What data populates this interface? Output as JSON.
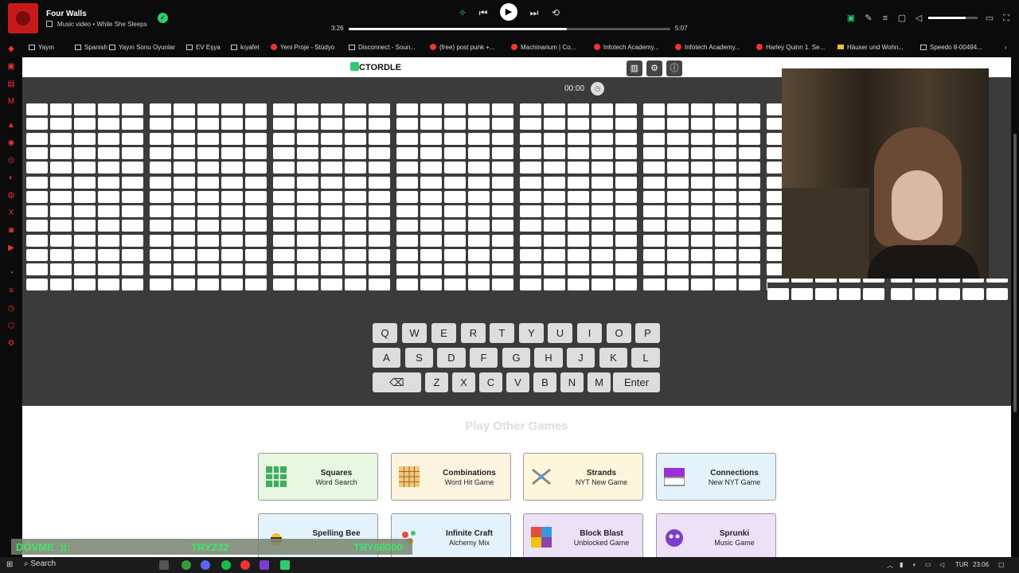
{
  "player": {
    "title": "Four Walls",
    "subtitle": "Music video • While She Sleeps",
    "current_time": "3:26",
    "total_time": "5:07",
    "progress": 0.678,
    "volume": 0.75
  },
  "bookmarks": [
    {
      "label": "Yayın",
      "icon": "folder"
    },
    {
      "label": "Spanish",
      "icon": "folder"
    },
    {
      "label": "Yayın Sonu Oyunlar",
      "icon": "folder"
    },
    {
      "label": "EV Eşya",
      "icon": "folder"
    },
    {
      "label": "kıyafet",
      "icon": "folder"
    },
    {
      "label": "Yeni Proje - Stüdyo",
      "icon": "red"
    },
    {
      "label": "Disconnect - Soun...",
      "icon": "link"
    },
    {
      "label": "(free) post punk +...",
      "icon": "red"
    },
    {
      "label": "Machinarium | Co...",
      "icon": "red"
    },
    {
      "label": "Infotech Academy...",
      "icon": "red"
    },
    {
      "label": "Infotech Academy...",
      "icon": "red"
    },
    {
      "label": "Harley Quinn 1. Se...",
      "icon": "red"
    },
    {
      "label": "Häuser und Wohn...",
      "icon": "yellow"
    },
    {
      "label": "Speedo 8-00494...",
      "icon": "link"
    }
  ],
  "game": {
    "logo_rest": "CTORDLE",
    "timer": "00:00"
  },
  "keyboard": {
    "row1": [
      "Q",
      "W",
      "E",
      "R",
      "T",
      "Y",
      "U",
      "I",
      "O",
      "P"
    ],
    "row2": [
      "A",
      "S",
      "D",
      "F",
      "G",
      "H",
      "J",
      "K",
      "L"
    ],
    "row3": [
      "⌫",
      "Z",
      "X",
      "C",
      "V",
      "B",
      "N",
      "M",
      "Enter"
    ]
  },
  "other_games": {
    "heading": "Play Other Games",
    "cards": [
      {
        "title": "Squares",
        "subtitle": "Word Search",
        "color": "#e8f7e1"
      },
      {
        "title": "Combinations",
        "subtitle": "Word Hit Game",
        "color": "#fdf4e0"
      },
      {
        "title": "Strands",
        "subtitle": "NYT New Game",
        "color": "#fdf6dc"
      },
      {
        "title": "Connections",
        "subtitle": "New NYT Game",
        "color": "#e4f3fb"
      },
      {
        "title": "Spelling Bee",
        "subtitle": "",
        "color": "#e4f3fb"
      },
      {
        "title": "Infinite Craft",
        "subtitle": "Alchemy Mix",
        "color": "#e4f3fb"
      },
      {
        "title": "Block Blast",
        "subtitle": "Unblocked Game",
        "color": "#ece1f7"
      },
      {
        "title": "Sprunki",
        "subtitle": "Music Game",
        "color": "#ece1f7"
      }
    ]
  },
  "overlay": {
    "left": "DÖVME :)(:",
    "mid": "TRY232",
    "right": "TRY60000"
  },
  "taskbar": {
    "search": "Search",
    "lang": "TUR",
    "time": "23:06"
  }
}
